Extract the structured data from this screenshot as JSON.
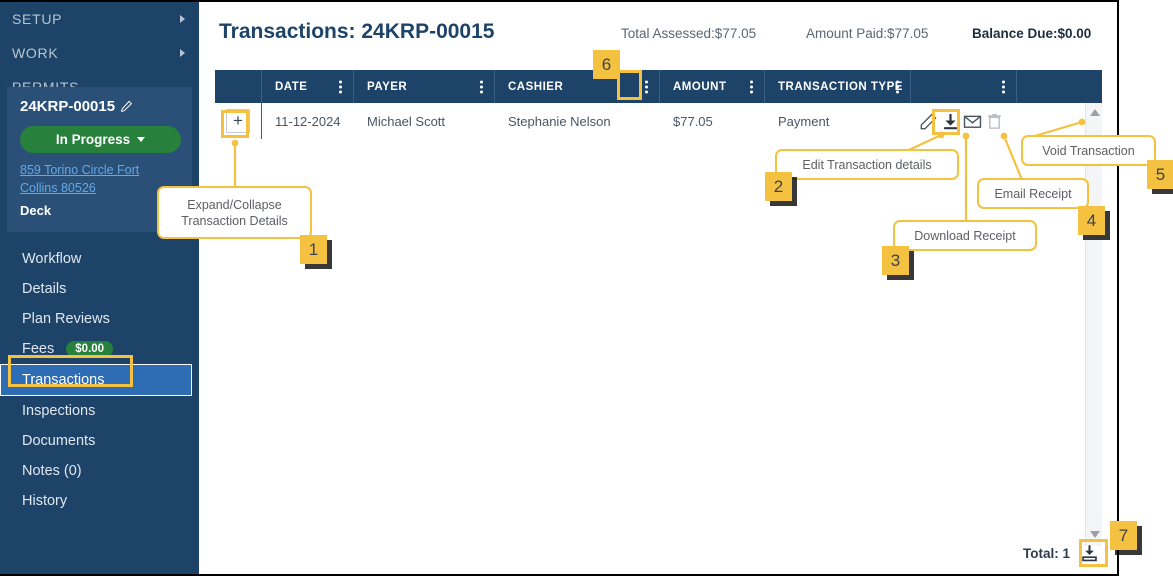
{
  "sidebar": {
    "groups": [
      {
        "label": "SETUP",
        "has_caret": true
      },
      {
        "label": "WORK",
        "has_caret": true
      },
      {
        "label": "PERMITS",
        "has_caret": false
      }
    ],
    "record": {
      "id": "24KRP-00015",
      "edit_icon": "pencil-icon",
      "status": "In Progress",
      "status_color": "#27803c",
      "address": "859 Torino Circle Fort Collins 80526",
      "type": "Deck"
    },
    "nav_items": [
      {
        "label": "Workflow",
        "selected": false
      },
      {
        "label": "Details",
        "selected": false
      },
      {
        "label": "Plan Reviews",
        "selected": false
      },
      {
        "label": "Fees",
        "badge": "$0.00",
        "selected": false
      },
      {
        "label": "Transactions",
        "selected": true
      },
      {
        "label": "Inspections",
        "selected": false
      },
      {
        "label": "Documents",
        "selected": false
      },
      {
        "label": "Notes  (0)",
        "selected": false
      },
      {
        "label": "History",
        "selected": false
      }
    ]
  },
  "header": {
    "title": "Transactions: 24KRP-00015",
    "total_assessed": "Total Assessed:$77.05",
    "amount_paid": "Amount Paid:$77.05",
    "balance_due": "Balance Due:$0.00"
  },
  "table": {
    "columns": [
      {
        "label": "",
        "kebab": false
      },
      {
        "label": "DATE",
        "kebab": true
      },
      {
        "label": "PAYER",
        "kebab": true
      },
      {
        "label": "CASHIER",
        "kebab": true
      },
      {
        "label": "AMOUNT",
        "kebab": true
      },
      {
        "label": "TRANSACTION TYPE",
        "kebab": true
      },
      {
        "label": "",
        "kebab": true
      },
      {
        "label": "",
        "kebab": false
      }
    ],
    "rows": [
      {
        "expand": "+",
        "date": "11-12-2024",
        "payer": "Michael Scott",
        "cashier": "Stephanie Nelson",
        "amount": "$77.05",
        "transaction_type": "Payment",
        "actions": [
          "edit-pencil-icon",
          "download-icon",
          "email-icon",
          "trash-icon"
        ]
      }
    ],
    "footer_total": "Total: 1",
    "export_icon": "export-download-icon"
  },
  "annotations": [
    {
      "number": "1",
      "text": "Expand/Collapse\nTransaction Details"
    },
    {
      "number": "2",
      "text": "Edit Transaction details"
    },
    {
      "number": "3",
      "text": "Download Receipt"
    },
    {
      "number": "4",
      "text": "Email Receipt"
    },
    {
      "number": "5",
      "text": "Void Transaction"
    },
    {
      "number": "6",
      "text": ""
    },
    {
      "number": "7",
      "text": ""
    }
  ],
  "colors": {
    "sidebar_bg": "#1d4368",
    "card_bg": "#2b5077",
    "accent_yellow": "#f5c141",
    "selected_nav": "#2e6cb3",
    "link_blue": "#63a8e8",
    "red_bar": "#c8373c"
  }
}
